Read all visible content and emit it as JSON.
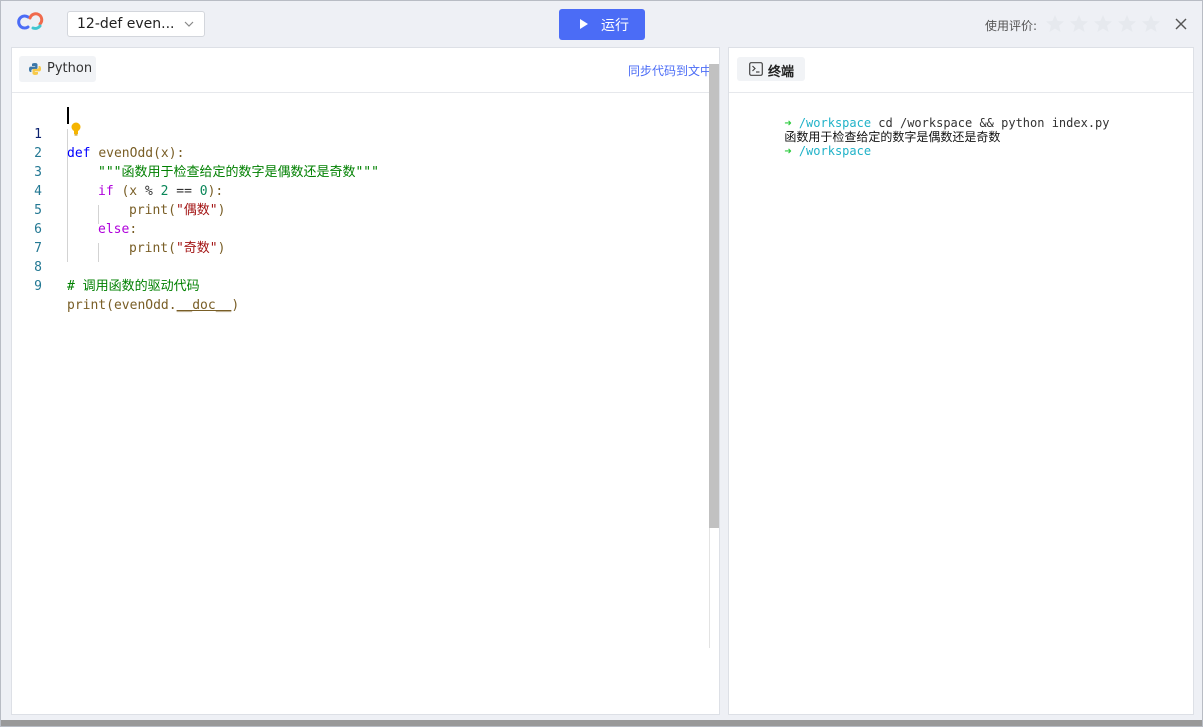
{
  "header": {
    "file_name": "12-def even...",
    "run_label": "运行",
    "rating_label": "使用评价:",
    "star_count": 5,
    "accent_color": "#4b6cf6"
  },
  "editor": {
    "language_label": "Python",
    "sync_label": "同步代码到文中",
    "line_numbers": [
      "1",
      "2",
      "3",
      "4",
      "5",
      "6",
      "7",
      "8",
      "9"
    ],
    "code": {
      "l1_kw": "def",
      "l1_fn": "evenOdd(x):",
      "l2_doc": "\"\"\"函数用于检查给定的数字是偶数还是奇数\"\"\"",
      "l3_kw": "if",
      "l3_a": " (x ",
      "l3_op": "%",
      "l3_b": " ",
      "l3_n1": "2",
      "l3_c": " == ",
      "l3_n2": "0",
      "l3_d": "):",
      "l4_fn": "print(",
      "l4_str": "\"偶数\"",
      "l4_end": ")",
      "l5_kw": "else",
      "l5_end": ":",
      "l6_fn": "print(",
      "l6_str": "\"奇数\"",
      "l6_end": ")",
      "l8_cmt": "# 调用函数的驱动代码",
      "l9_fn": "print(evenOdd.",
      "l9_attr": "__doc__",
      "l9_end": ")"
    }
  },
  "terminal": {
    "tab_label": "终端",
    "lines": [
      {
        "arrow": "➜",
        "path": "/workspace",
        "cmd": " cd /workspace && python index.py"
      },
      {
        "output": "函数用于检查给定的数字是偶数还是奇数"
      },
      {
        "arrow": "➜",
        "path": "/workspace",
        "cmd": ""
      }
    ]
  }
}
